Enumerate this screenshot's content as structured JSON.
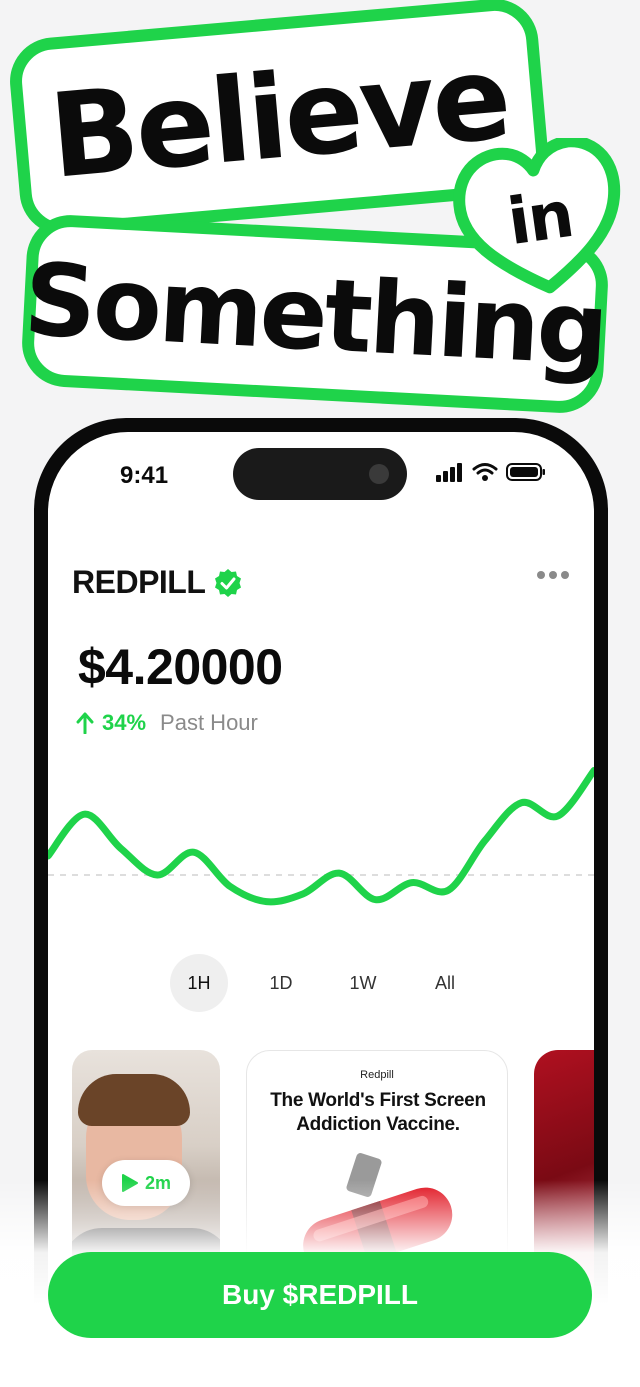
{
  "colors": {
    "accent": "#1fd34a",
    "text": "#0b0b0b",
    "muted": "#8a8a8a"
  },
  "headline": {
    "line1": "Believe",
    "connector": "in",
    "line2": "Something"
  },
  "status_bar": {
    "time": "9:41",
    "icons": [
      "signal-icon",
      "wifi-icon",
      "battery-icon"
    ]
  },
  "token": {
    "name": "REDPILL",
    "verified_icon": "verified-badge-icon",
    "price": "$4.20000",
    "change_pct": "34%",
    "change_period": "Past Hour"
  },
  "chart_data": {
    "type": "line",
    "series": [
      {
        "values": [
          40,
          62,
          44,
          30,
          42,
          24,
          16,
          20,
          31,
          17,
          26,
          22,
          48,
          68,
          61,
          85
        ]
      }
    ],
    "ylim": [
      0,
      100
    ],
    "baseline": 30
  },
  "ranges": [
    {
      "label": "1H",
      "active": true
    },
    {
      "label": "1D",
      "active": false
    },
    {
      "label": "1W",
      "active": false
    },
    {
      "label": "All",
      "active": false
    }
  ],
  "cards": {
    "video": {
      "duration": "2m"
    },
    "ad": {
      "brand": "Redpill",
      "headline_line1": "The World's First Screen",
      "headline_line2": "Addiction Vaccine."
    }
  },
  "cta": {
    "label": "Buy $REDPILL"
  }
}
